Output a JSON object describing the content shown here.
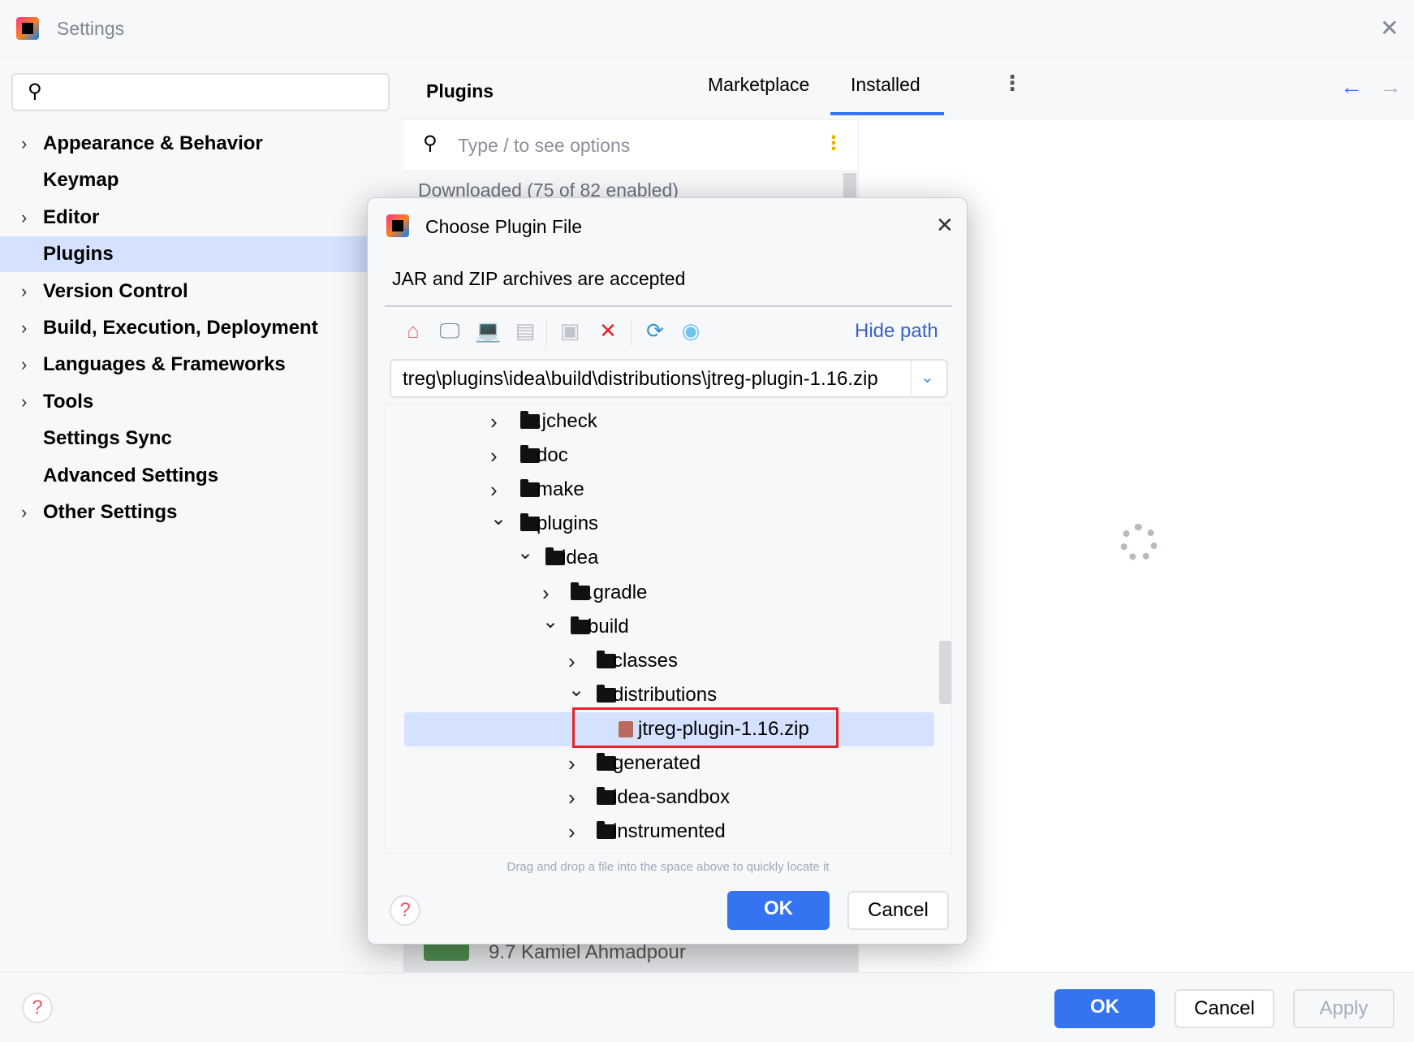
{
  "window": {
    "title": "Settings",
    "close_icon": "close-icon"
  },
  "sidebar": {
    "search_placeholder": "",
    "items": [
      {
        "label": "Appearance & Behavior",
        "expandable": true
      },
      {
        "label": "Keymap",
        "expandable": false
      },
      {
        "label": "Editor",
        "expandable": true
      },
      {
        "label": "Plugins",
        "expandable": false,
        "selected": true
      },
      {
        "label": "Version Control",
        "expandable": true
      },
      {
        "label": "Build, Execution, Deployment",
        "expandable": true
      },
      {
        "label": "Languages & Frameworks",
        "expandable": true
      },
      {
        "label": "Tools",
        "expandable": true
      },
      {
        "label": "Settings Sync",
        "expandable": false
      },
      {
        "label": "Advanced Settings",
        "expandable": false
      },
      {
        "label": "Other Settings",
        "expandable": true
      }
    ]
  },
  "header": {
    "title": "Plugins",
    "tabs": [
      {
        "label": "Marketplace"
      },
      {
        "label": "Installed",
        "active": true
      }
    ]
  },
  "plugins": {
    "search_placeholder": "Type / to see options",
    "group_label": "Downloaded (75 of 82 enabled)",
    "partial_row": "9.7  Kamiel Ahmadpour"
  },
  "dialog": {
    "title": "Choose Plugin File",
    "description": "JAR and ZIP archives are accepted",
    "toolbar": [
      "home-icon",
      "desktop-icon",
      "project-icon",
      "module-icon",
      "new-folder-icon",
      "delete-icon",
      "refresh-icon",
      "show-hidden-icon"
    ],
    "hide_path": "Hide path",
    "path": "treg\\plugins\\idea\\build\\distributions\\jtreg-plugin-1.16.zip",
    "tree": [
      {
        "label": ".jcheck",
        "level": 0,
        "expanded": false,
        "type": "folder"
      },
      {
        "label": "doc",
        "level": 0,
        "expanded": false,
        "type": "folder"
      },
      {
        "label": "make",
        "level": 0,
        "expanded": false,
        "type": "folder"
      },
      {
        "label": "plugins",
        "level": 0,
        "expanded": true,
        "type": "folder"
      },
      {
        "label": "idea",
        "level": 1,
        "expanded": true,
        "type": "folder"
      },
      {
        "label": ".gradle",
        "level": 2,
        "expanded": false,
        "type": "folder"
      },
      {
        "label": "build",
        "level": 2,
        "expanded": true,
        "type": "folder"
      },
      {
        "label": "classes",
        "level": 3,
        "expanded": false,
        "type": "folder"
      },
      {
        "label": "distributions",
        "level": 3,
        "expanded": true,
        "type": "folder"
      },
      {
        "label": "jtreg-plugin-1.16.zip",
        "level": 4,
        "type": "file",
        "selected": true
      },
      {
        "label": "generated",
        "level": 3,
        "expanded": false,
        "type": "folder"
      },
      {
        "label": "idea-sandbox",
        "level": 3,
        "expanded": false,
        "type": "folder"
      },
      {
        "label": "instrumented",
        "level": 3,
        "expanded": false,
        "type": "folder"
      }
    ],
    "hint": "Drag and drop a file into the space above to quickly locate it",
    "ok": "OK",
    "cancel": "Cancel"
  },
  "footer": {
    "ok": "OK",
    "cancel": "Cancel",
    "apply": "Apply"
  },
  "colors": {
    "accent": "#3574f0",
    "selection": "#d4e2ff",
    "highlight_box": "#e5252a"
  }
}
